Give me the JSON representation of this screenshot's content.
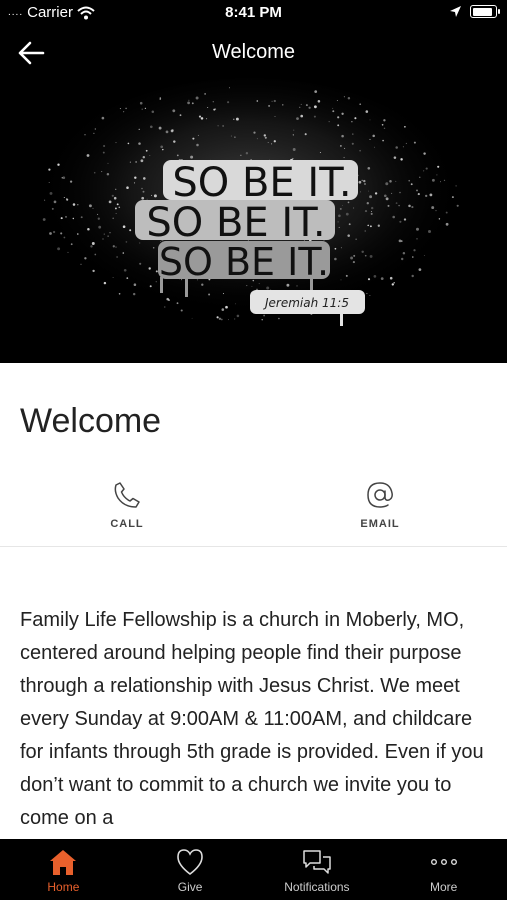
{
  "status_bar": {
    "signal": "....",
    "carrier": "Carrier",
    "time": "8:41 PM",
    "battery_level": 0.95
  },
  "nav": {
    "title": "Welcome",
    "back_icon": "back-arrow-icon"
  },
  "hero": {
    "lines": [
      "SO BE IT.",
      "SO BE IT.",
      "SO BE IT."
    ],
    "reference": "Jeremiah 11:5"
  },
  "page": {
    "title": "Welcome"
  },
  "actions": [
    {
      "label": "CALL",
      "icon": "phone-icon"
    },
    {
      "label": "EMAIL",
      "icon": "at-sign-icon"
    }
  ],
  "body": {
    "text": "Family Life Fellowship is a church in Moberly, MO, centered around helping people find their purpose through a relationship with Jesus Christ. We meet every Sunday at 9:00AM & 11:00AM, and childcare for infants through 5th grade is provided.  Even if you don’t want to commit to a church we invite you to come on a"
  },
  "tabs": [
    {
      "label": "Home",
      "icon": "home-icon",
      "active": true
    },
    {
      "label": "Give",
      "icon": "heart-icon",
      "active": false
    },
    {
      "label": "Notifications",
      "icon": "chat-bubbles-icon",
      "active": false
    },
    {
      "label": "More",
      "icon": "more-dots-icon",
      "active": false
    }
  ],
  "colors": {
    "accent": "#e8602c",
    "bar_background": "#000000"
  }
}
